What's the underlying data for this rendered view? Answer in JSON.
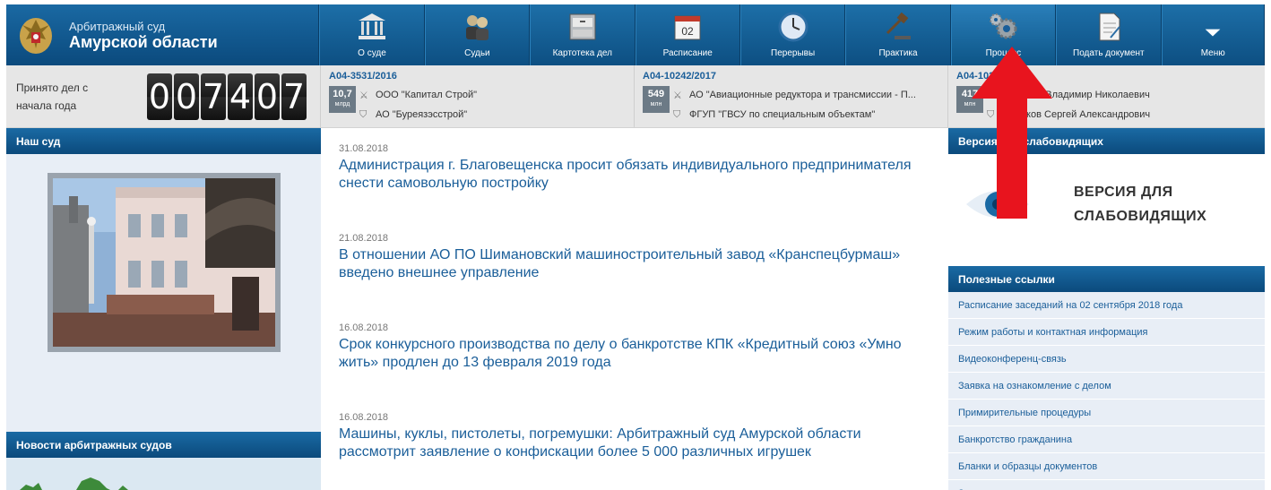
{
  "header": {
    "court_small": "Арбитражный суд",
    "court_big": "Амурской области",
    "nav": [
      {
        "label": "О суде",
        "icon": "courthouse-icon"
      },
      {
        "label": "Судьи",
        "icon": "judges-icon"
      },
      {
        "label": "Картотека дел",
        "icon": "file-cabinet-icon"
      },
      {
        "label": "Расписание",
        "icon": "calendar-icon"
      },
      {
        "label": "Перерывы",
        "icon": "clock-icon"
      },
      {
        "label": "Практика",
        "icon": "gavel-icon"
      },
      {
        "label": "Процесс",
        "icon": "gears-icon"
      },
      {
        "label": "Подать документ",
        "icon": "document-icon"
      },
      {
        "label": "Меню",
        "icon": "chevron-down-icon"
      }
    ],
    "calendar_day": "02"
  },
  "stats": {
    "label_line1": "Принято дел с",
    "label_line2": "начала года",
    "digits": [
      "0",
      "0",
      "7",
      "4",
      "0",
      "7"
    ]
  },
  "cases": [
    {
      "number": "А04-3531/2016",
      "amount": "10,7",
      "unit": "млрд",
      "plaintiff": "ООО \"Капитал Строй\"",
      "defendant": "АО \"Буреязэсстрой\""
    },
    {
      "number": "А04-10242/2017",
      "amount": "549",
      "unit": "млн",
      "plaintiff": "АО \"Авиационные редуктора и трансмиссии - П...",
      "defendant": "ФГУП \"ГВСУ по специальным объектам\""
    },
    {
      "number": "А04-10216/2016",
      "amount": "417",
      "unit": "млн",
      "plaintiff": "Мельник Владимир Николаевич",
      "defendant": "Новиков Сергей Александрович"
    }
  ],
  "left": {
    "our_court": "Наш суд",
    "arb_news": "Новости арбитражных судов"
  },
  "news": [
    {
      "date": "31.08.2018",
      "title": "Администрация г. Благовещенска просит обязать индивидуального предпринимателя снести самовольную постройку"
    },
    {
      "date": "21.08.2018",
      "title": "В отношении АО ПО Шимановский машиностроительный завод «Кранспецбурмаш» введено внешнее управление"
    },
    {
      "date": "16.08.2018",
      "title": "Срок конкурсного производства по делу о банкротстве КПК «Кредитный союз «Умно жить» продлен до 13 февраля 2019 года"
    },
    {
      "date": "16.08.2018",
      "title": "Машины, куклы, пистолеты, погремушки: Арбитражный суд Амурской области рассмотрит заявление о конфискации более 5 000 различных игрушек"
    }
  ],
  "right": {
    "vision_head": "Версия для слабовидящих",
    "vision_line1": "ВЕРСИЯ ДЛЯ",
    "vision_line2": "СЛАБОВИДЯЩИХ",
    "links_head": "Полезные ссылки",
    "links": [
      "Расписание заседаний на 02 сентября 2018 года",
      "Режим работы и контактная информация",
      "Видеоконференц-связь",
      "Заявка на ознакомление с делом",
      "Примирительные процедуры",
      "Банкротство гражданина",
      "Бланки и образцы документов",
      "Задать вопрос председателю"
    ]
  },
  "colors": {
    "accent": "#1a5e99",
    "header": "#0d4f82",
    "arrow": "#e8141e"
  }
}
